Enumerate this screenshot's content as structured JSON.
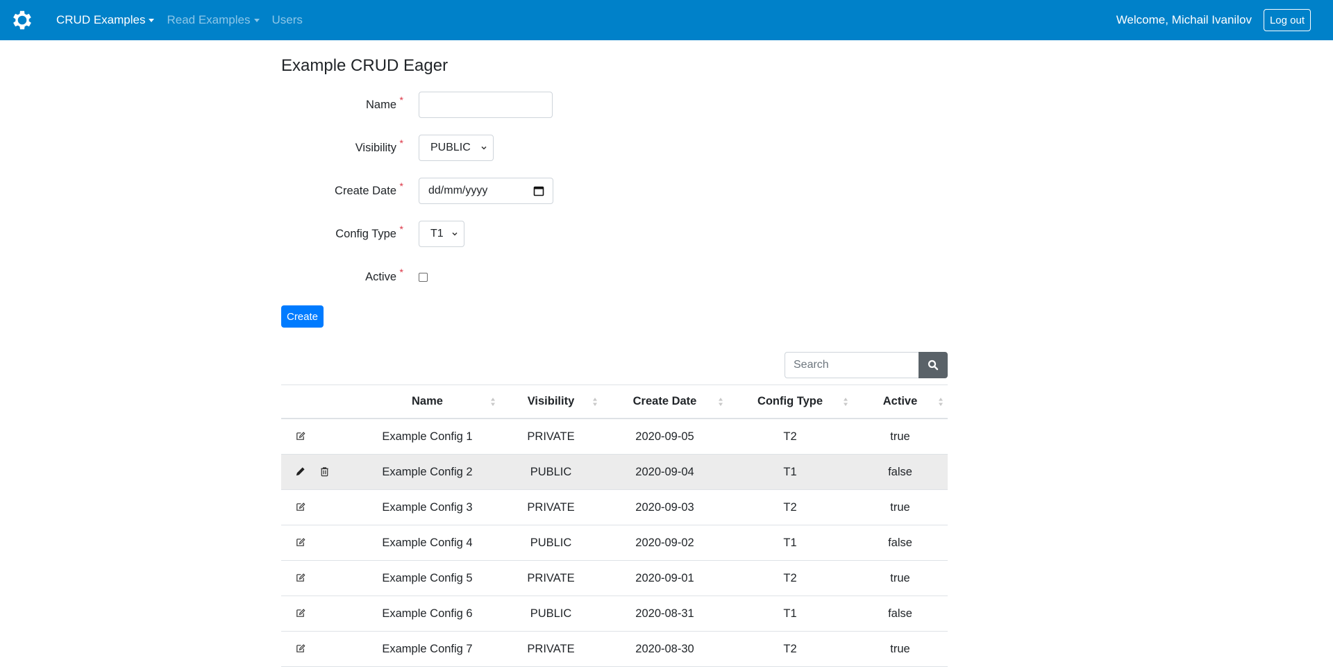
{
  "navbar": {
    "logo_icon": "gear-icon",
    "links": [
      {
        "label": "CRUD Examples",
        "dropdown": true,
        "active": true
      },
      {
        "label": "Read Examples",
        "dropdown": true,
        "active": false
      },
      {
        "label": "Users",
        "dropdown": false,
        "active": false
      }
    ],
    "welcome": "Welcome, Michail Ivanilov",
    "logout_label": "Log out",
    "brand_color": "#0081c9"
  },
  "page": {
    "title": "Example CRUD Eager"
  },
  "form": {
    "fields": {
      "name": {
        "label": "Name",
        "value": "",
        "required": "*"
      },
      "visibility": {
        "label": "Visibility",
        "value": "PUBLIC",
        "required": "*"
      },
      "create_date": {
        "label": "Create Date",
        "placeholder": "dd/mm/yyyy",
        "required": "*"
      },
      "config_type": {
        "label": "Config Type",
        "value": "T1",
        "required": "*"
      },
      "active": {
        "label": "Active",
        "checked": false,
        "required": "*"
      }
    },
    "create_label": "Create"
  },
  "search": {
    "placeholder": "Search",
    "button_icon": "search-icon"
  },
  "table": {
    "columns": [
      "",
      "Name",
      "Visibility",
      "Create Date",
      "Config Type",
      "Active"
    ],
    "rows": [
      {
        "name": "Example Config 1",
        "visibility": "PRIVATE",
        "create_date": "2020-09-05",
        "config_type": "T2",
        "active": "true",
        "hovered": false
      },
      {
        "name": "Example Config 2",
        "visibility": "PUBLIC",
        "create_date": "2020-09-04",
        "config_type": "T1",
        "active": "false",
        "hovered": true
      },
      {
        "name": "Example Config 3",
        "visibility": "PRIVATE",
        "create_date": "2020-09-03",
        "config_type": "T2",
        "active": "true",
        "hovered": false
      },
      {
        "name": "Example Config 4",
        "visibility": "PUBLIC",
        "create_date": "2020-09-02",
        "config_type": "T1",
        "active": "false",
        "hovered": false
      },
      {
        "name": "Example Config 5",
        "visibility": "PRIVATE",
        "create_date": "2020-09-01",
        "config_type": "T2",
        "active": "true",
        "hovered": false
      },
      {
        "name": "Example Config 6",
        "visibility": "PUBLIC",
        "create_date": "2020-08-31",
        "config_type": "T1",
        "active": "false",
        "hovered": false
      },
      {
        "name": "Example Config 7",
        "visibility": "PRIVATE",
        "create_date": "2020-08-30",
        "config_type": "T2",
        "active": "true",
        "hovered": false
      }
    ]
  }
}
